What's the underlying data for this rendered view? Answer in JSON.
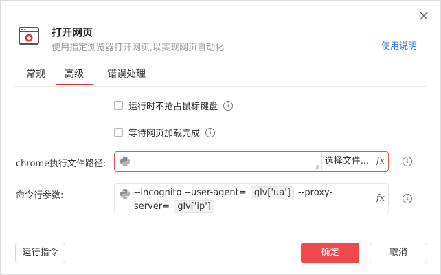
{
  "dialog": {
    "title": "打开网页",
    "subtitle": "使用指定浏览器打开网页,以实现网页自动化",
    "help_link": "使用说明"
  },
  "tabs": [
    {
      "label": "常规",
      "active": false
    },
    {
      "label": "高级",
      "active": true
    },
    {
      "label": "错误处理",
      "active": false
    }
  ],
  "options": {
    "no_grab_input": {
      "label": "运行时不抢占鼠标键盘",
      "checked": false
    },
    "wait_page_load": {
      "label": "等待网页加载完成",
      "checked": false
    }
  },
  "chrome_path": {
    "label": "chrome执行文件路径:",
    "value": "",
    "choose_button": "选择文件...",
    "fx_label": "fx"
  },
  "cmd_args": {
    "label": "命令行参数:",
    "text1": "--incognito --user-agent=",
    "chip1": "glv['ua']",
    "text2": "--proxy-server=",
    "chip2": "glv['ip']",
    "fx_label": "fx"
  },
  "footer": {
    "run_button": "运行指令",
    "ok_button": "确定",
    "cancel_button": "取消"
  },
  "colors": {
    "accent": "#ee4a4f",
    "link": "#2f7bd8",
    "tab_underline": "#e33b3b"
  },
  "icons": {
    "close": "close-icon",
    "app": "browser-window-icon",
    "info": "info-icon",
    "python": "python-icon"
  }
}
